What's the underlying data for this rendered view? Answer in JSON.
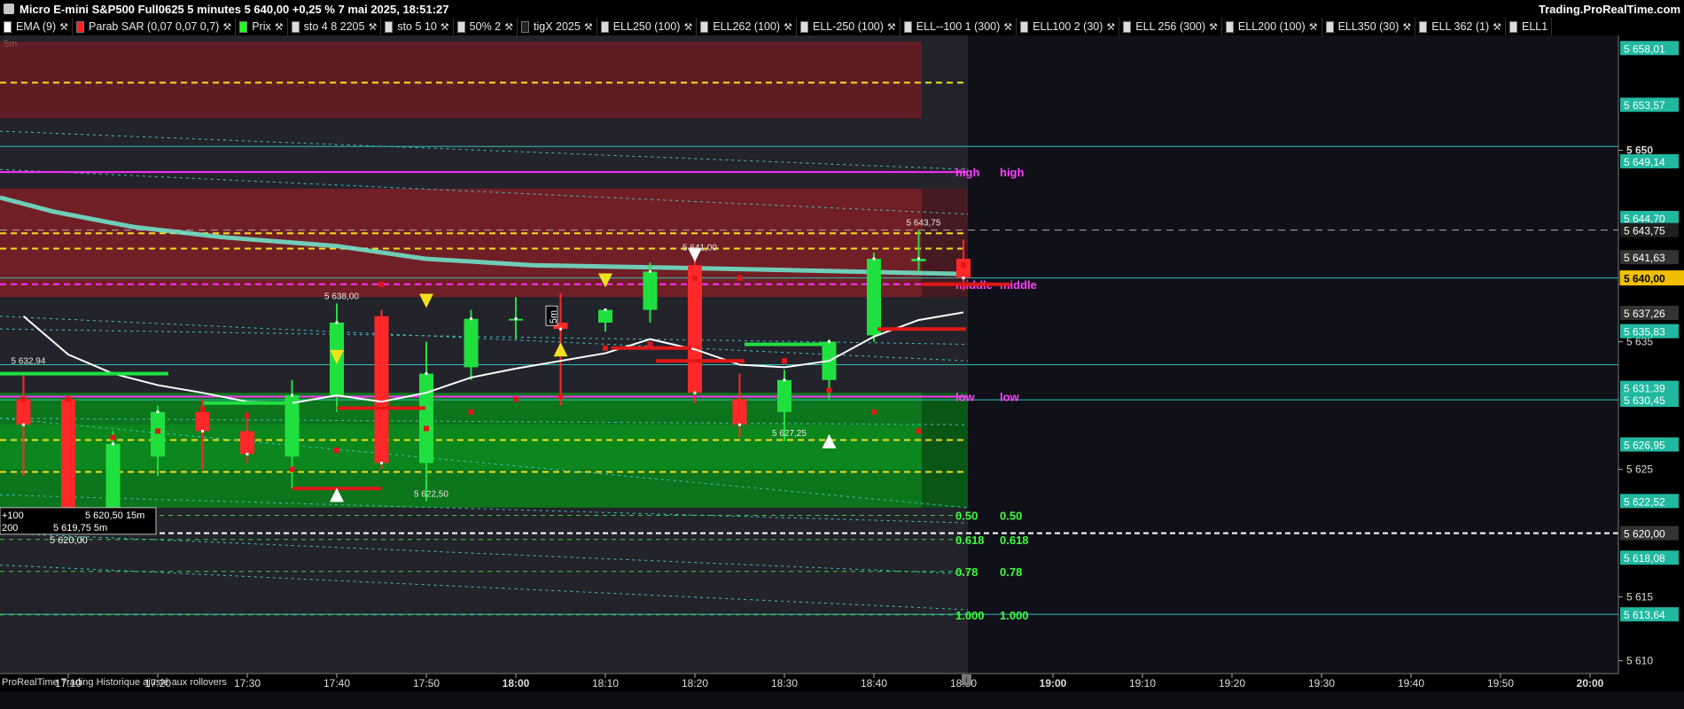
{
  "window": {
    "title": "Micro E-mini S&P500 Full0625 5 minutes 5 640,00 +0,25 % 7 mai 2025, 18:51:27",
    "brand": "Trading.ProRealTime.com"
  },
  "legend": [
    {
      "label": "EMA (9)",
      "color": "#ffffff",
      "wrench": true
    },
    {
      "label": "Parab SAR (0,07 0,07 0,7)",
      "color": "#ff2020",
      "wrench": true
    },
    {
      "label": "Prix",
      "color": "#20ff20",
      "wrench": true
    },
    {
      "label": "sto 4 8 2205",
      "color": "#dddddd",
      "wrench": true
    },
    {
      "label": "sto 5 10",
      "color": "#dddddd",
      "wrench": true
    },
    {
      "label": "50% 2",
      "color": "#dddddd",
      "wrench": true
    },
    {
      "label": "tigX 2025",
      "color": "#222222",
      "wrench": true
    },
    {
      "label": "ELL250 (100)",
      "color": "#dddddd",
      "wrench": true
    },
    {
      "label": "ELL262 (100)",
      "color": "#dddddd",
      "wrench": true
    },
    {
      "label": "ELL-250 (100)",
      "color": "#dddddd",
      "wrench": true
    },
    {
      "label": "ELL--100 1 (300)",
      "color": "#dddddd",
      "wrench": true
    },
    {
      "label": "ELL100 2 (30)",
      "color": "#dddddd",
      "wrench": true
    },
    {
      "label": "ELL 256 (300)",
      "color": "#dddddd",
      "wrench": true
    },
    {
      "label": "ELL200 (100)",
      "color": "#dddddd",
      "wrench": true
    },
    {
      "label": "ELL350 (30)",
      "color": "#dddddd",
      "wrench": true
    },
    {
      "label": "ELL 362 (1)",
      "color": "#dddddd",
      "wrench": true
    },
    {
      "label": "ELL1",
      "color": "#dddddd",
      "wrench": false
    }
  ],
  "footnote": "ProRealTime Trading  Historique ajusté aux rollovers",
  "chart_data": {
    "type": "candlestick",
    "timeframe_label": "5m",
    "y_range": [
      5609.0,
      5659.0
    ],
    "x_ticks": [
      {
        "label": "17:10",
        "bold": false
      },
      {
        "label": "17:20",
        "bold": false
      },
      {
        "label": "17:30",
        "bold": false
      },
      {
        "label": "17:40",
        "bold": false
      },
      {
        "label": "17:50",
        "bold": false
      },
      {
        "label": "18:00",
        "bold": true
      },
      {
        "label": "18:10",
        "bold": false
      },
      {
        "label": "18:20",
        "bold": false
      },
      {
        "label": "18:30",
        "bold": false
      },
      {
        "label": "18:40",
        "bold": false
      },
      {
        "label": "18:50",
        "bold": false
      },
      {
        "label": "19:00",
        "bold": true
      },
      {
        "label": "19:10",
        "bold": false
      },
      {
        "label": "19:20",
        "bold": false
      },
      {
        "label": "19:30",
        "bold": false
      },
      {
        "label": "19:40",
        "bold": false
      },
      {
        "label": "19:50",
        "bold": false
      },
      {
        "label": "20:00",
        "bold": true
      }
    ],
    "y_ticks": [
      "5 610",
      "5 615",
      "5 625",
      "5 635",
      "5 650"
    ],
    "price_tags": [
      {
        "label": "5 658,01",
        "value": 5658.01,
        "color": "#20b8a0"
      },
      {
        "label": "5 653,57",
        "value": 5653.57,
        "color": "#20b8a0"
      },
      {
        "label": "5 649,14",
        "value": 5649.14,
        "color": "#20b8a0"
      },
      {
        "label": "5 644,70",
        "value": 5644.7,
        "color": "#20b8a0"
      },
      {
        "label": "5 643,75",
        "value": 5643.75,
        "color": "#202020"
      },
      {
        "label": "5 641,63",
        "value": 5641.63,
        "color": "#333333"
      },
      {
        "label": "5 640,00",
        "value": 5640.0,
        "color": "#f0c000"
      },
      {
        "label": "5 637,26",
        "value": 5637.26,
        "color": "#333333"
      },
      {
        "label": "5 635,83",
        "value": 5635.83,
        "color": "#20b8a0"
      },
      {
        "label": "5 631,39",
        "value": 5631.39,
        "color": "#20b8a0"
      },
      {
        "label": "5 630,45",
        "value": 5630.45,
        "color": "#20b8a0"
      },
      {
        "label": "5 626,95",
        "value": 5626.95,
        "color": "#20b8a0"
      },
      {
        "label": "5 622,52",
        "value": 5622.52,
        "color": "#20b8a0"
      },
      {
        "label": "5 620,00",
        "value": 5620.0,
        "color": "#333333"
      },
      {
        "label": "5 618,08",
        "value": 5618.08,
        "color": "#20b8a0"
      },
      {
        "label": "5 613,64",
        "value": 5613.64,
        "color": "#20b8a0"
      }
    ],
    "candles": [
      {
        "time": "17:05",
        "open": 5630.5,
        "high": 5632.5,
        "low": 5624.5,
        "close": 5628.5
      },
      {
        "time": "17:10",
        "open": 5630.5,
        "high": 5630.8,
        "low": 5620.5,
        "close": 5621.5
      },
      {
        "time": "17:15",
        "open": 5621.5,
        "high": 5628.0,
        "low": 5620.5,
        "close": 5627.0
      },
      {
        "time": "17:20",
        "open": 5626.0,
        "high": 5630.0,
        "low": 5624.5,
        "close": 5629.5
      },
      {
        "time": "17:25",
        "open": 5629.5,
        "high": 5630.5,
        "low": 5625.0,
        "close": 5628.0
      },
      {
        "time": "17:30",
        "open": 5628.0,
        "high": 5629.5,
        "low": 5625.5,
        "close": 5626.2
      },
      {
        "time": "17:35",
        "open": 5626.0,
        "high": 5632.0,
        "low": 5623.5,
        "close": 5630.8
      },
      {
        "time": "17:40",
        "open": 5630.8,
        "high": 5638.0,
        "low": 5629.5,
        "close": 5636.5
      },
      {
        "time": "17:45",
        "open": 5637.0,
        "high": 5637.5,
        "low": 5625.0,
        "close": 5625.5
      },
      {
        "time": "17:50",
        "open": 5625.5,
        "high": 5635.0,
        "low": 5622.5,
        "close": 5632.5
      },
      {
        "time": "17:55",
        "open": 5633.0,
        "high": 5637.5,
        "low": 5632.0,
        "close": 5636.8
      },
      {
        "time": "18:00",
        "open": 5636.8,
        "high": 5638.5,
        "low": 5635.2,
        "close": 5636.8
      },
      {
        "time": "18:05",
        "open": 5636.5,
        "high": 5638.8,
        "low": 5630.0,
        "close": 5636.0
      },
      {
        "time": "18:10",
        "open": 5636.5,
        "high": 5637.5,
        "low": 5635.8,
        "close": 5637.5
      },
      {
        "time": "18:15",
        "open": 5637.5,
        "high": 5641.2,
        "low": 5636.5,
        "close": 5640.5
      },
      {
        "time": "18:20",
        "open": 5641.0,
        "high": 5641.8,
        "low": 5630.2,
        "close": 5631.0
      },
      {
        "time": "18:25",
        "open": 5630.5,
        "high": 5632.5,
        "low": 5627.5,
        "close": 5628.5
      },
      {
        "time": "18:30",
        "open": 5629.5,
        "high": 5632.8,
        "low": 5627.2,
        "close": 5632.0
      },
      {
        "time": "18:35",
        "open": 5632.0,
        "high": 5635.2,
        "low": 5630.5,
        "close": 5635.0
      },
      {
        "time": "18:40",
        "open": 5635.5,
        "high": 5642.0,
        "low": 5635.0,
        "close": 5641.5
      },
      {
        "time": "18:45",
        "open": 5641.3,
        "high": 5643.75,
        "low": 5640.5,
        "close": 5641.5
      },
      {
        "time": "18:50",
        "open": 5641.5,
        "high": 5643.0,
        "low": 5639.0,
        "close": 5640.0
      }
    ],
    "candle_labels": [
      {
        "text": "5 632,94",
        "time": "17:05",
        "value": 5632.94
      },
      {
        "text": "5 638,00",
        "time": "17:40",
        "value": 5638.0
      },
      {
        "text": "5 622,50",
        "time": "17:50",
        "value": 5622.5
      },
      {
        "text": "5 641,00",
        "time": "18:20",
        "value": 5641.8
      },
      {
        "text": "5 627,25",
        "time": "18:30",
        "value": 5627.25
      },
      {
        "text": "5 643,75",
        "time": "18:45",
        "value": 5643.75
      }
    ],
    "ema9": [
      5637.0,
      5634.0,
      5632.5,
      5631.6,
      5631.0,
      5630.3,
      5630.2,
      5630.8,
      5630.3,
      5631.0,
      5632.2,
      5632.9,
      5633.5,
      5634.1,
      5635.2,
      5634.4,
      5633.2,
      5633.0,
      5633.5,
      5635.4,
      5636.7,
      5637.3
    ],
    "sar": [
      5630.5,
      5630.5,
      5627.5,
      5628.0,
      5629.7,
      5629.2,
      5625.0,
      5626.5,
      5639.5,
      5628.2,
      5629.5,
      5630.5,
      5630.7,
      5634.5,
      5634.8,
      5640.0,
      5640.0,
      5633.5,
      5631.2,
      5629.5,
      5628.0,
      5641.0
    ],
    "horizontal_levels": [
      {
        "label": "high",
        "value": 5648.3,
        "color": "#ff40ff",
        "style": "solid"
      },
      {
        "label": "middle",
        "value": 5639.5,
        "color": "#ff40ff",
        "style": "dashed"
      },
      {
        "label": "low",
        "value": 5630.7,
        "color": "#ff40ff",
        "style": "solid"
      },
      {
        "label": "0.50",
        "value": 5621.4,
        "color": "#3cff3c",
        "style": "dashed"
      },
      {
        "label": "0.618",
        "value": 5619.5,
        "color": "#3cff3c",
        "style": "dashed"
      },
      {
        "label": "0.78",
        "value": 5617.0,
        "color": "#3cff3c",
        "style": "dashed"
      },
      {
        "label": "1.000",
        "value": 5613.6,
        "color": "#3cff3c",
        "style": "dashed"
      }
    ],
    "info_box": [
      {
        "left": "+100",
        "right": "5 620,50 15m"
      },
      {
        "left": "200",
        "right": "5 619,75 5m"
      },
      {
        "left": "",
        "right": "5 620,00"
      }
    ]
  }
}
